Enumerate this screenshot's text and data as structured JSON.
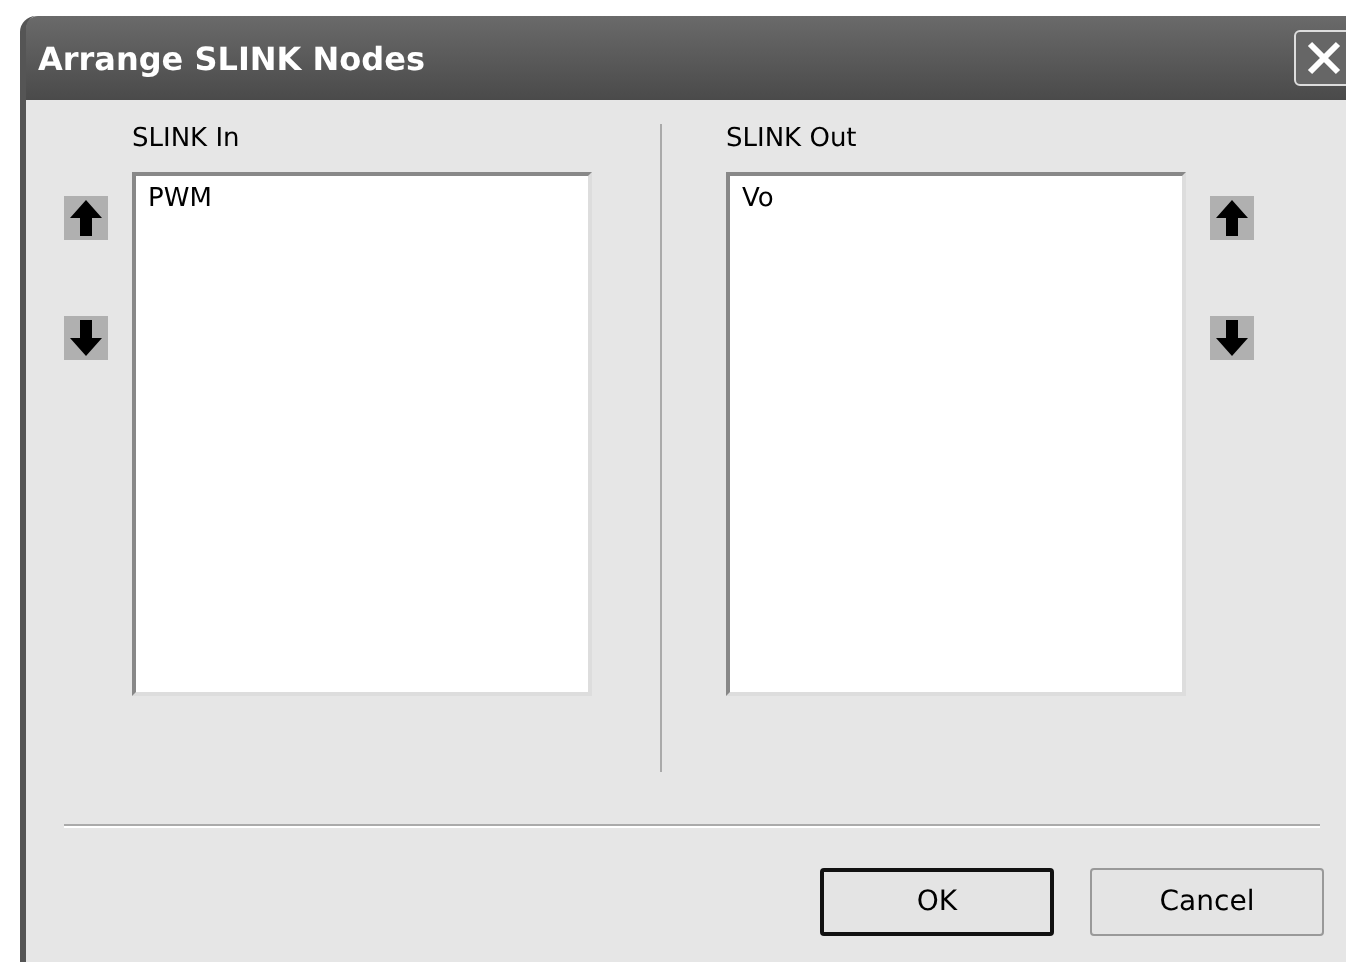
{
  "window": {
    "title": "Arrange SLINK Nodes"
  },
  "lists": [
    {
      "label": "SLINK In",
      "items": [
        "PWM"
      ]
    },
    {
      "label": "SLINK Out",
      "items": [
        "Vo"
      ]
    }
  ],
  "buttons": [
    {
      "label": "OK",
      "default": true
    },
    {
      "label": "Cancel",
      "default": false
    }
  ]
}
